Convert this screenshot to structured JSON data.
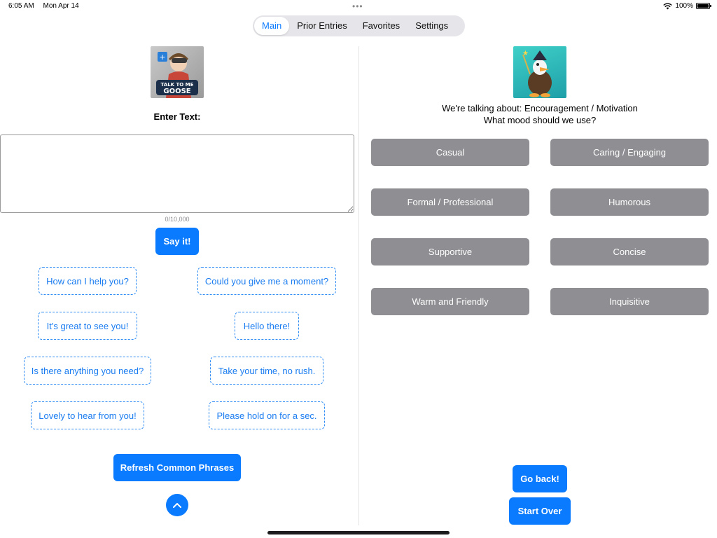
{
  "status": {
    "time": "6:05 AM",
    "date": "Mon Apr 14",
    "battery": "100%",
    "multitask_dots": "•••",
    "icons": [
      "wifi-icon",
      "battery-icon"
    ]
  },
  "tabs": [
    {
      "label": "Main",
      "active": true
    },
    {
      "label": "Prior Entries",
      "active": false
    },
    {
      "label": "Favorites",
      "active": false
    },
    {
      "label": "Settings",
      "active": false
    }
  ],
  "left": {
    "logo": "talk-to-me-goose-logo",
    "logo_text": "TALK TO ME GOOSE",
    "enter_label": "Enter Text:",
    "text_value": "",
    "char_count": "0/10,000",
    "say_button": "Say it!",
    "phrases": [
      "How can I help you?",
      "Could you give me a moment?",
      "It's great to see you!",
      "Hello there!",
      "Is there anything you need?",
      "Take your time, no rush.",
      "Lovely to hear from you!",
      "Please hold on for a sec."
    ],
    "refresh_button": "Refresh Common Phrases",
    "up_button_icon": "chevron-up-icon"
  },
  "right": {
    "logo": "wizard-goose-image",
    "topic_line": "We're talking about: Encouragement / Motivation",
    "mood_question": "What mood should we use?",
    "moods": [
      "Casual",
      "Caring / Engaging",
      "Formal / Professional",
      "Humorous",
      "Supportive",
      "Concise",
      "Warm and Friendly",
      "Inquisitive"
    ],
    "go_back_button": "Go back!",
    "start_over_button": "Start Over"
  },
  "colors": {
    "accent": "#0a7aff",
    "mood_button": "#8e8e93",
    "tab_bg": "#e6e6ea"
  }
}
